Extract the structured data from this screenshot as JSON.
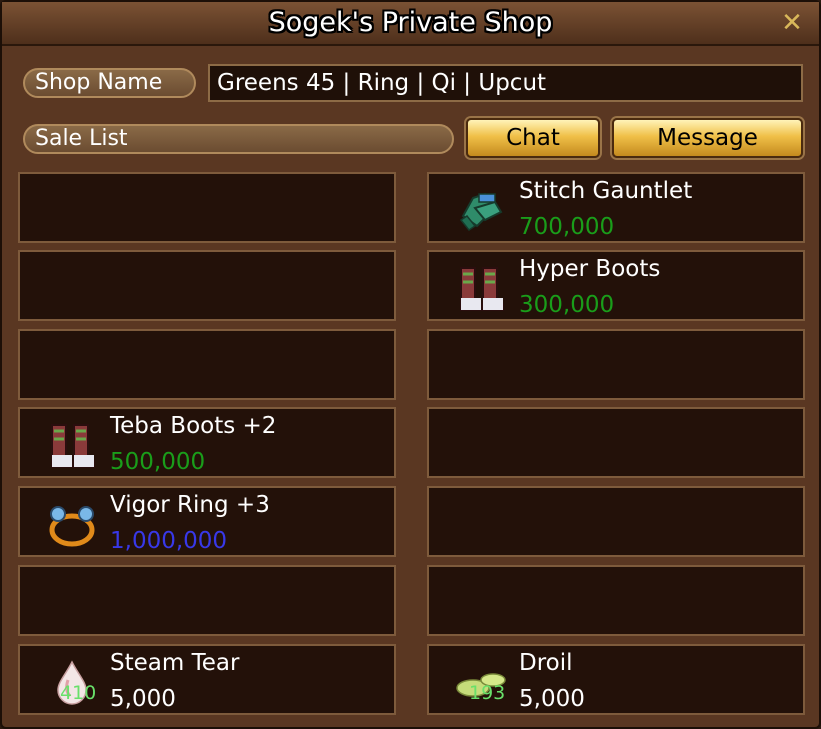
{
  "window": {
    "title": "Sogek's Private Shop",
    "close_icon": "close-icon"
  },
  "shop": {
    "name_label": "Shop Name",
    "name_value": "Greens 45 | Ring | Qi | Upcut",
    "sale_list_label": "Sale List"
  },
  "buttons": {
    "chat": "Chat",
    "message": "Message"
  },
  "colors": {
    "green_price": "#1a9d1a",
    "blue_price": "#3838e8",
    "white_price": "#ffffff",
    "quantity": "#69e06a"
  },
  "slots": [
    {
      "empty": true
    },
    {
      "name": "Stitch Gauntlet",
      "price": "700,000",
      "price_color": "green",
      "icon": "gauntlet-icon"
    },
    {
      "empty": true
    },
    {
      "name": "Hyper Boots",
      "price": "300,000",
      "price_color": "green",
      "icon": "boots-icon"
    },
    {
      "empty": true
    },
    {
      "empty": true
    },
    {
      "name": "Teba Boots +2",
      "price": "500,000",
      "price_color": "green",
      "icon": "boots-icon"
    },
    {
      "empty": true
    },
    {
      "name": "Vigor Ring +3",
      "price": "1,000,000",
      "price_color": "blue",
      "icon": "ring-icon"
    },
    {
      "empty": true
    },
    {
      "empty": true
    },
    {
      "empty": true
    },
    {
      "name": "Steam Tear",
      "price": "5,000",
      "price_color": "white",
      "icon": "tear-icon",
      "quantity": "410"
    },
    {
      "name": "Droil",
      "price": "5,000",
      "price_color": "white",
      "icon": "droil-icon",
      "quantity": "193"
    }
  ]
}
